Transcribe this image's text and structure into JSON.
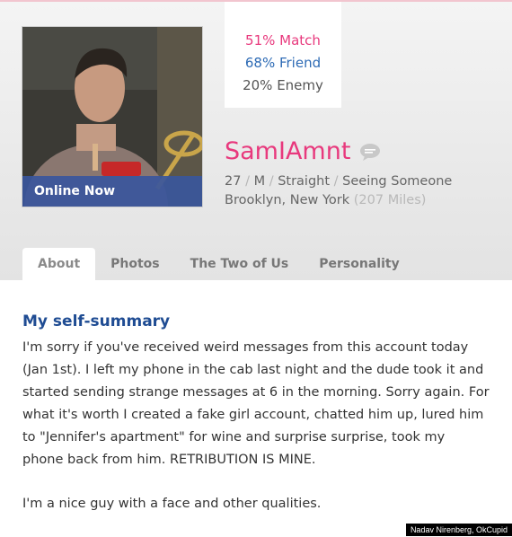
{
  "profile": {
    "username": "SamIAmnt",
    "status_badge": "Online Now",
    "age": "27",
    "gender": "M",
    "orientation": "Straight",
    "relationship": "Seeing Someone",
    "location": "Brooklyn, New York",
    "distance": "(207 Miles)"
  },
  "match": {
    "match_text": "51% Match",
    "friend_text": "68% Friend",
    "enemy_text": "20% Enemy"
  },
  "separator": "/",
  "tabs": [
    {
      "label": "About",
      "active": true
    },
    {
      "label": "Photos",
      "active": false
    },
    {
      "label": "The Two of Us",
      "active": false
    },
    {
      "label": "Personality",
      "active": false
    }
  ],
  "essay": {
    "title": "My self-summary",
    "paragraph_1": "I'm sorry if you've received weird messages from this account today (Jan 1st). I left my phone in the cab last night and the dude took it and started sending strange messages at 6 in the morning. Sorry again. For what it's worth I created a fake girl account, chatted him up, lured him to \"Jennifer's apartment\" for wine and surprise surprise, took my phone back from him. RETRIBUTION IS MINE.",
    "paragraph_2": "I'm a nice guy with a face and other qualities."
  },
  "credit": "Nadav Nirenberg, OkCupid",
  "icons": {
    "chat": "chat-bubble-icon"
  },
  "colors": {
    "match": "#e8397d",
    "friend": "#2e6bb5",
    "enemy": "#555555",
    "username": "#e8397d",
    "section_title": "#1f4c93",
    "online_bar": "#3a569c"
  }
}
